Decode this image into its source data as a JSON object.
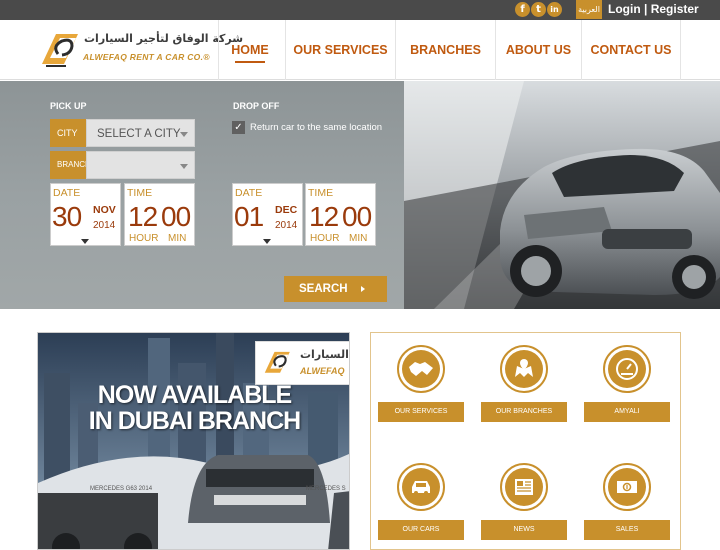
{
  "topbar": {
    "social": [
      {
        "icon": "facebook-icon",
        "glyph": "f"
      },
      {
        "icon": "twitter-icon",
        "glyph": "t"
      },
      {
        "icon": "linkedin-icon",
        "glyph": "in"
      }
    ],
    "language": "العربية",
    "login": "Login",
    "separator": "|",
    "register": "Register"
  },
  "logo": {
    "arabic": "شركة الوفاق لتأجير السيارات",
    "english": "ALWEFAQ RENT A CAR CO.®"
  },
  "nav": [
    "HOME",
    "OUR SERVICES",
    "BRANCHES",
    "ABOUT US",
    "CONTACT US"
  ],
  "booking": {
    "pickup_label": "PICK UP",
    "dropoff_label": "DROP OFF",
    "city_tag": "CITY",
    "city_value": "SELECT A CITY",
    "branch_tag": "BRANCH",
    "branch_value": "",
    "return_same_checked": true,
    "return_same_label": "Return car to the same location",
    "pickup_date": {
      "label": "DATE",
      "day": "30",
      "month": "NOV",
      "year": "2014"
    },
    "pickup_time": {
      "label": "TIME",
      "hour": "12",
      "min": "00",
      "hour_label": "HOUR",
      "min_label": "MIN"
    },
    "dropoff_date": {
      "label": "DATE",
      "day": "01",
      "month": "DEC",
      "year": "2014"
    },
    "dropoff_time": {
      "label": "TIME",
      "hour": "12",
      "min": "00",
      "hour_label": "HOUR",
      "min_label": "MIN"
    },
    "search": "SEARCH"
  },
  "promo": {
    "logo_arabic": "السيارات",
    "logo_english": "ALWEFAQ",
    "line1": "NOW AVAILABLE",
    "line2": "IN DUBAI BRANCH",
    "car1": "MERCEDES G63 2014",
    "car2": "MERCEDES S"
  },
  "services": [
    {
      "label": "OUR SERVICES",
      "icon": "handshake-icon"
    },
    {
      "label": "OUR BRANCHES",
      "icon": "map-pin-icon"
    },
    {
      "label": "AMYALI",
      "icon": "speedometer-icon"
    },
    {
      "label": "OUR CARS",
      "icon": "car-icon"
    },
    {
      "label": "NEWS",
      "icon": "newspaper-icon"
    },
    {
      "label": "SALES",
      "icon": "cash-icon"
    }
  ],
  "colors": {
    "accent": "#c8902c",
    "nav_text": "#c05a10",
    "topbar": "#4a4a4a",
    "booking_bg": "#9aa1a3"
  }
}
